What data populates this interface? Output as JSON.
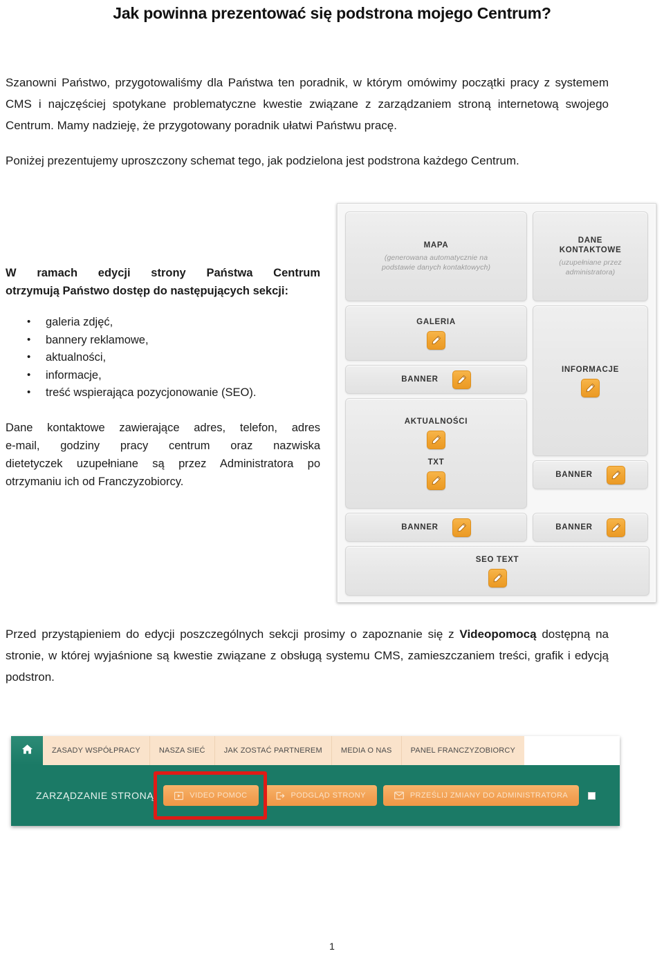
{
  "document": {
    "title": "Jak powinna prezentować się podstrona mojego Centrum?",
    "page_number": "1"
  },
  "intro": {
    "paragraph_1": "Szanowni Państwo, przygotowaliśmy dla Państwa ten poradnik, w którym omówimy początki pracy z systemem CMS i najczęściej spotykane problematyczne kwestie związane z zarządzaniem stroną internetową swojego Centrum. Mamy nadzieję, że przygotowany poradnik ułatwi Państwu pracę.",
    "paragraph_2": "Poniżej prezentujemy uproszczony schemat tego, jak podzielona jest podstrona każdego Centrum."
  },
  "left_column": {
    "lead_line_1": "W ramach edycji strony Państwa Centrum",
    "lead_line_2": "otrzymują Państwo dostęp do następujących sekcji:",
    "sections": [
      "galeria zdjęć,",
      "bannery reklamowe,",
      "aktualności,",
      "informacje,",
      "treść wspierająca pozycjonowanie (SEO)."
    ],
    "admin_note_line_1": "Dane kontaktowe zawierające adres, telefon, adres",
    "admin_note_line_2": "e-mail, godziny pracy centrum oraz nazwiska",
    "admin_note_line_3": "dietetyczek uzupełniane są przez Administratora po",
    "admin_note_line_4": "otrzymaniu ich od Franczyzobiorcy."
  },
  "diagram": {
    "left_column_cells": [
      {
        "title": "MAPA",
        "note": "(generowana automatycznie na podstawie danych kontaktowych)",
        "has_edit_icon": false
      },
      {
        "title": "GALERIA",
        "note": "",
        "has_edit_icon": true
      },
      {
        "title": "BANNER",
        "note": "",
        "has_edit_icon": true
      },
      {
        "title": "AKTUALNOŚCI",
        "title_2": "TXT",
        "note": "",
        "has_edit_icon": true
      },
      {
        "title": "BANNER",
        "note": "",
        "has_edit_icon": true
      }
    ],
    "right_column_cells": [
      {
        "title": "DANE KONTAKTOWE",
        "title_line_1": "DANE",
        "title_line_2": "KONTAKTOWE",
        "note": "(uzupełniane przez administratora)",
        "has_edit_icon": false
      },
      {
        "title": "INFORMACJE",
        "note": "",
        "has_edit_icon": true
      },
      {
        "title": "BANNER",
        "note": "",
        "has_edit_icon": true
      },
      {
        "title": "BANNER",
        "note": "",
        "has_edit_icon": true
      }
    ],
    "full_width_cell": {
      "title": "SEO TEXT",
      "has_edit_icon": true
    },
    "edit_icon_name": "pencil-edit-icon",
    "accent_color": "#f0a431"
  },
  "closing": {
    "text_part_1": "Przed przystąpieniem do edycji poszczególnych sekcji prosimy o zapoznanie się z ",
    "bold_word": "Videopomocą",
    "text_part_2": " dostępną na stronie, w której wyjaśnione są kwestie związane z obsługą systemu CMS, zamieszczaniem treści, grafik i edycją podstron."
  },
  "cms_screenshot": {
    "home_icon": "home-icon",
    "nav_tabs": [
      "ZASADY WSPÓŁPRACY",
      "NASZA SIEĆ",
      "JAK ZOSTAĆ PARTNEREM",
      "MEDIA O NAS",
      "PANEL FRANCZYZOBIORCY"
    ],
    "manage_label": "ZARZĄDZANIE STRONĄ",
    "buttons": [
      {
        "label": "VIDEO POMOC",
        "icon": "video-icon",
        "highlighted": true
      },
      {
        "label": "PODGLĄD STRONY",
        "icon": "external-link-icon",
        "highlighted": false
      },
      {
        "label": "PRZEŚLIJ ZMIANY DO ADMINISTRATORA",
        "icon": "envelope-icon",
        "highlighted": false
      }
    ],
    "green_color": "#1b7a66",
    "tab_color": "#fae3cb",
    "button_color": "#f2a053",
    "highlight_color": "#e01b16"
  }
}
